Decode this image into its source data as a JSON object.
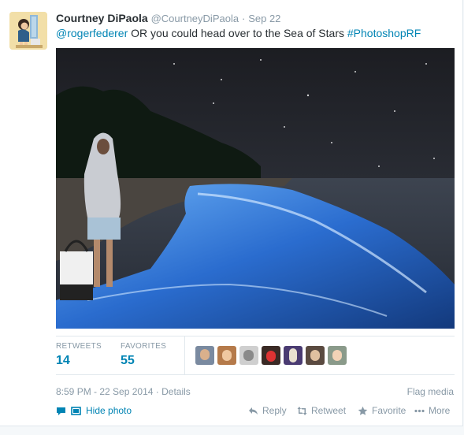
{
  "tweet": {
    "name": "Courtney DiPaola",
    "handle": "@CourtneyDiPaola",
    "separator": "·",
    "date": "Sep 22",
    "text": {
      "mention": "@rogerfederer",
      "body": " OR you could head over to the Sea of Stars ",
      "hashtag": "#PhotoshopRF"
    }
  },
  "stats": {
    "retweets_label": "RETWEETS",
    "retweets_value": "14",
    "favorites_label": "FAVORITES",
    "favorites_value": "55"
  },
  "meta": {
    "timestamp": "8:59 PM - 22 Sep 2014",
    "separator": "·",
    "details": "Details",
    "flag": "Flag media"
  },
  "actions": {
    "hide_photo": "Hide photo",
    "reply": "Reply",
    "retweet": "Retweet",
    "favorite": "Favorite",
    "more": "More"
  },
  "colors": {
    "link": "#0084b4",
    "muted": "#8899a6",
    "border": "#e1e8ed"
  }
}
